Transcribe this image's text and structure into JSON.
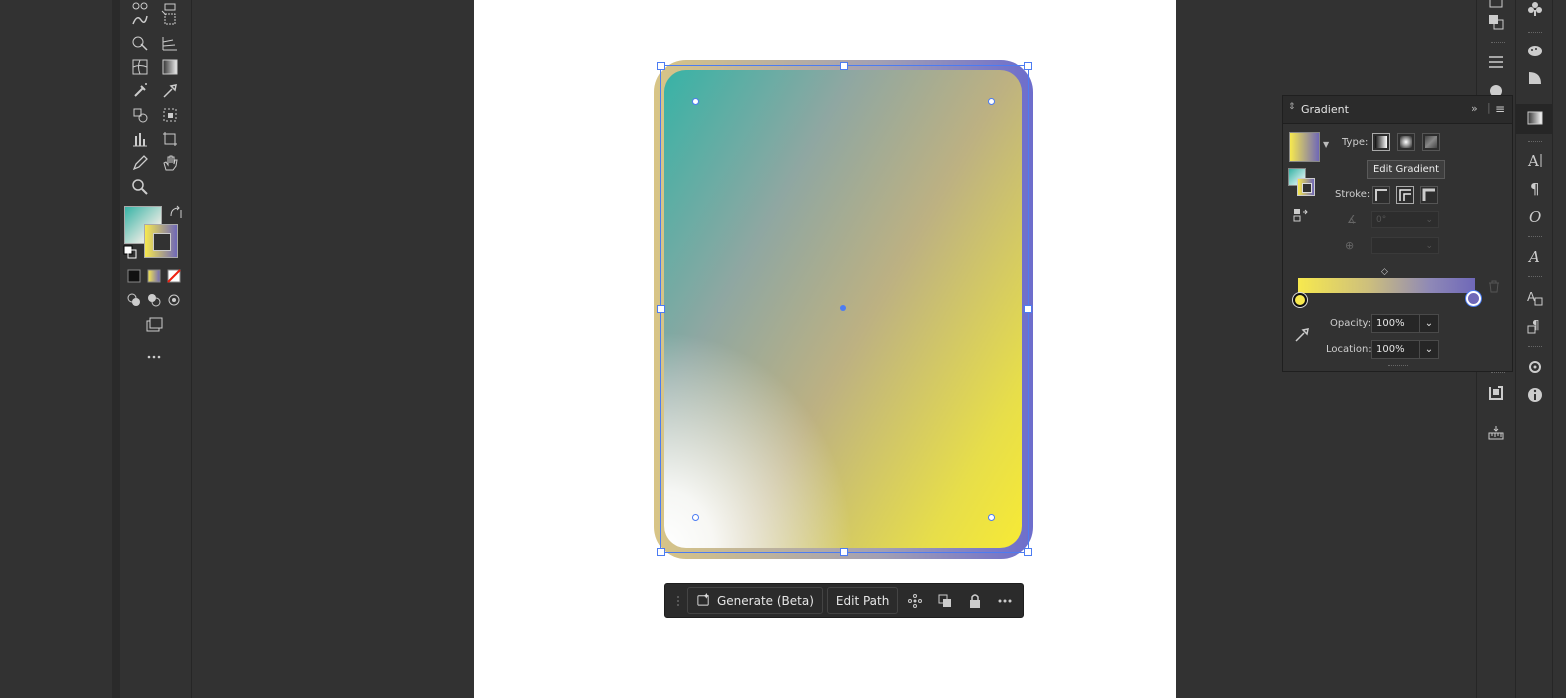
{
  "context_bar": {
    "generate_label": "Generate (Beta)",
    "edit_path_label": "Edit Path"
  },
  "gradient_panel": {
    "title": "Gradient",
    "type_label": "Type:",
    "stroke_label": "Stroke:",
    "tooltip": "Edit Gradient",
    "angle_value": "0°",
    "opacity_label": "Opacity:",
    "opacity_value": "100%",
    "location_label": "Location:",
    "location_value": "100%"
  },
  "colors": {
    "gradient_start": "#f7e94e",
    "gradient_end": "#6f68b8",
    "selection": "#4c7cf2"
  },
  "icons": {
    "left_toolbar": [
      "blend-icon",
      "artboard-icon",
      "shape-builder-icon",
      "perspective-grid-icon",
      "mesh-icon",
      "gradient-icon",
      "symbol-sprayer-icon",
      "eyedropper-icon",
      "live-paint-icon",
      "live-paint-select-icon",
      "column-graph-icon",
      "slice-icon",
      "pencil-icon",
      "hand-icon",
      "zoom-icon"
    ],
    "dock": [
      "swatches-icon",
      "pathfinder-icon",
      "align-icon",
      "brushes-icon",
      "symbols-icon",
      "graphic-styles-icon",
      "transparency-icon",
      "gradient-icon",
      "character-icon",
      "paragraph-icon",
      "opentype-icon",
      "glyphs-icon",
      "character-styles-icon",
      "paragraph-styles-icon",
      "appearance-icon",
      "info-icon",
      "links-icon",
      "measure-icon"
    ]
  }
}
